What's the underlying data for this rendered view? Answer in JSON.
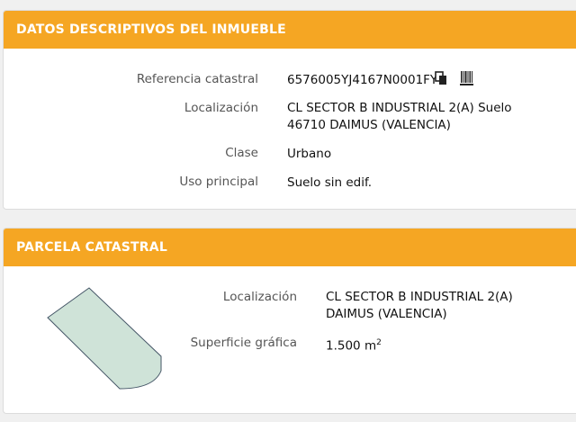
{
  "datos": {
    "title": "DATOS DESCRIPTIVOS DEL INMUEBLE",
    "fields": [
      {
        "label": "Referencia catastral",
        "value": "6576005YJ4167N0001FY"
      },
      {
        "label": "Localización",
        "lines": [
          "CL SECTOR B INDUSTRIAL 2(A) Suelo",
          "46710 DAIMUS (VALENCIA)"
        ]
      },
      {
        "label": "Clase",
        "value": "Urbano"
      },
      {
        "label": "Uso principal",
        "value": "Suelo sin edif."
      }
    ],
    "icons": [
      "copy-icon",
      "barcode-icon"
    ]
  },
  "parcela": {
    "title": "PARCELA CATASTRAL",
    "fields": [
      {
        "label": "Localización",
        "lines": [
          "CL SECTOR B INDUSTRIAL 2(A)",
          "DAIMUS (VALENCIA)"
        ]
      },
      {
        "label": "Superficie gráfica",
        "value": "1.500 m",
        "unit_sup": "2"
      }
    ]
  },
  "colors": {
    "header": "#f5a623",
    "parcel_fill": "#cfe3d8",
    "parcel_stroke": "#445566"
  }
}
